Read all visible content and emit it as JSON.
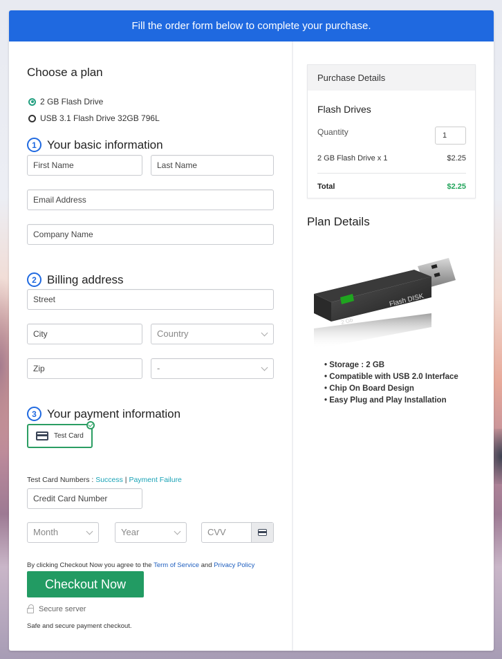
{
  "banner": {
    "text": "Fill the order form below to complete your purchase."
  },
  "plan": {
    "heading": "Choose a plan",
    "options": [
      {
        "label": "2 GB Flash Drive",
        "selected": true
      },
      {
        "label": "USB 3.1 Flash Drive 32GB 796L",
        "selected": false
      }
    ]
  },
  "basic_info": {
    "step": "1",
    "heading": "Your basic information",
    "first_name": "First Name",
    "last_name": "Last Name",
    "email": "Email Address",
    "company": "Company Name"
  },
  "billing": {
    "step": "2",
    "heading": "Billing address",
    "street": "Street",
    "city": "City",
    "country": "Country",
    "zip": "Zip",
    "state": "-"
  },
  "payment": {
    "step": "3",
    "heading": "Your payment information",
    "method": "Test Card",
    "test_numbers_label": "Test Card Numbers : ",
    "success_link": "Success",
    "separator": " | ",
    "failure_link": "Payment Failure",
    "card_number": "Credit Card Number",
    "month": "Month",
    "year": "Year",
    "cvv": "CVV"
  },
  "agreement": {
    "prefix": "By clicking Checkout Now you agree to the ",
    "terms": "Term of Service",
    "middle": " and ",
    "privacy": "Privacy Policy"
  },
  "checkout": {
    "button": "Checkout Now",
    "secure": "Secure server",
    "safe": "Safe and secure payment checkout."
  },
  "purchase": {
    "heading": "Purchase Details",
    "product": "Flash Drives",
    "quantity_label": "Quantity",
    "quantity": "1",
    "line_item": "2 GB Flash Drive x 1",
    "line_price": "$2.25",
    "total_label": "Total",
    "total": "$2.25"
  },
  "plan_details": {
    "heading": "Plan Details",
    "image_labels": {
      "brand": "Flash DISK",
      "capacity": "2 Gb"
    },
    "features": [
      "Storage : 2 GB",
      "Compatible with USB 2.0 Interface",
      "Chip On Board Design",
      "Easy Plug and Play Installation"
    ]
  },
  "colors": {
    "banner": "#1f69e0",
    "checkout": "#229b63",
    "total": "#21a45a",
    "link_teal": "#1aa3b6",
    "link_blue": "#1f5fbf"
  }
}
